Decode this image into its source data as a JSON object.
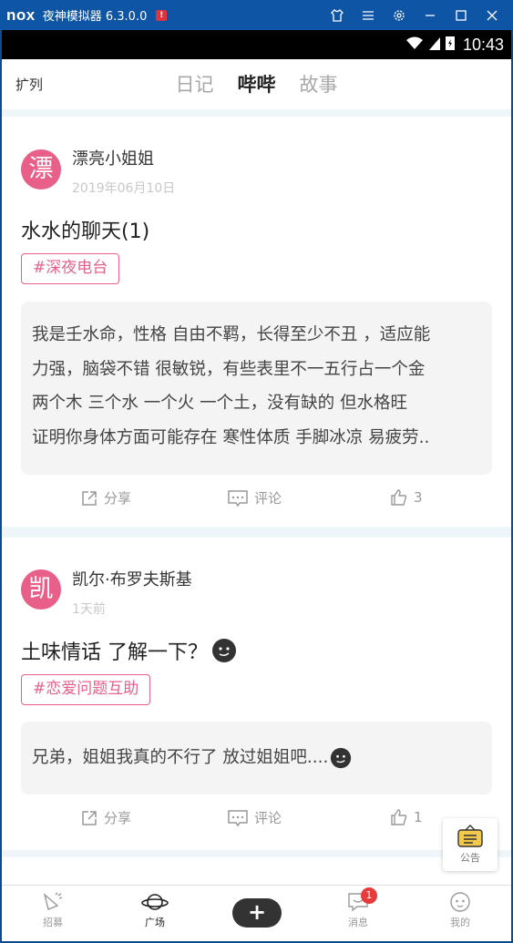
{
  "emulator": {
    "logo": "nox",
    "title": "夜神模拟器 6.3.0.0",
    "badge": "!"
  },
  "status_bar": {
    "time": "10:43"
  },
  "top_nav": {
    "left_label": "扩列",
    "tabs": [
      {
        "label": "日记",
        "active": false
      },
      {
        "label": "哔哔",
        "active": true
      },
      {
        "label": "故事",
        "active": false
      }
    ]
  },
  "posts": [
    {
      "avatar_char": "漂",
      "username": "漂亮小姐姐",
      "date": "2019年06月10日",
      "title": "水水的聊天(1)",
      "tag": "#深夜电台",
      "excerpt_lines": [
        "我是壬水命，性格 自由不羁，长得至少不丑 ，适应能",
        "力强，脑袋不错  很敏锐，有些表里不一五行占一个金",
        "两个木 三个水 一个火 一个土，没有缺的  但水格旺",
        "证明你身体方面可能存在 寒性体质  手脚冰凉 易疲劳.."
      ],
      "share_label": "分享",
      "comment_label": "评论",
      "likes": "3"
    },
    {
      "avatar_char": "凯",
      "username": "凯尔·布罗夫斯基",
      "date": "1天前",
      "title": "土味情话  了解一下？",
      "tag": "#恋爱问题互助",
      "excerpt_lines": [
        "兄弟，姐姐我真的不行了 放过姐姐吧...."
      ],
      "share_label": "分享",
      "comment_label": "评论",
      "likes": "1"
    }
  ],
  "notice": {
    "label": "公告"
  },
  "bottom_nav": {
    "items": [
      {
        "label": "招募",
        "active": false
      },
      {
        "label": "广场",
        "active": true
      },
      {
        "label": "消息",
        "active": false,
        "badge": "1"
      },
      {
        "label": "我的",
        "active": false
      }
    ],
    "plus": "+"
  },
  "colors": {
    "accent": "#e8608a",
    "emulator_bar": "#0e55a6",
    "background": "#eef6fa"
  }
}
